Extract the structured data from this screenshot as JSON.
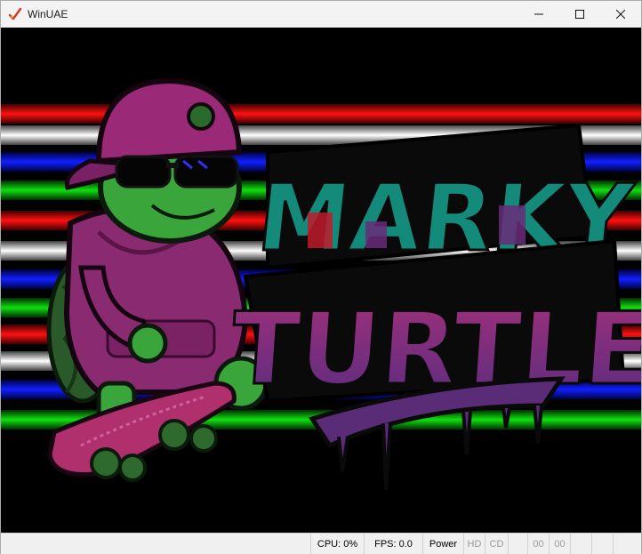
{
  "window": {
    "title": "WinUAE",
    "app_icon": "winuae-checkmark-icon",
    "controls": [
      "minimize-icon",
      "maximize-icon",
      "close-icon"
    ]
  },
  "display": {
    "logo_text_top": "MARKY",
    "logo_text_bottom": "TURTLE",
    "colors": {
      "background": "#000000",
      "stripe_red": "#e00000",
      "stripe_white": "#ffffff",
      "stripe_blue": "#0010e0",
      "stripe_green": "#00d000",
      "logo_teal": "#138a7a",
      "logo_magenta": "#8a2a78",
      "logo_purple": "#5a2c78",
      "turtle_green": "#3aa53a",
      "hoodie_pink": "#8a2a70",
      "cap_pink": "#9a2a78",
      "skateboard_pink": "#b0306e"
    }
  },
  "statusbar": {
    "cpu": "CPU: 0%",
    "fps": "FPS: 0.0",
    "power": "Power",
    "hd": "HD",
    "cd": "CD",
    "drive_df0": "00",
    "drive_df1": "00"
  }
}
